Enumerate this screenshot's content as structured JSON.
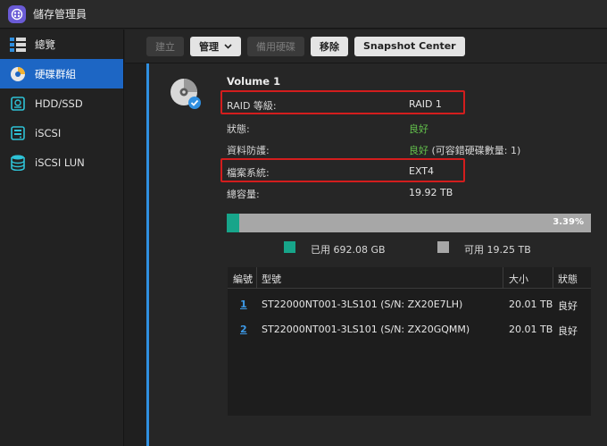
{
  "app": {
    "title": "儲存管理員"
  },
  "sidebar": {
    "items": [
      {
        "label": "總覽",
        "icon": "overview-icon"
      },
      {
        "label": "硬碟群組",
        "icon": "disk-group-icon",
        "active": true
      },
      {
        "label": "HDD/SSD",
        "icon": "hdd-icon"
      },
      {
        "label": "iSCSI",
        "icon": "iscsi-icon"
      },
      {
        "label": "iSCSI LUN",
        "icon": "iscsi-lun-icon"
      }
    ]
  },
  "toolbar": {
    "create": "建立",
    "manage": "管理",
    "spare": "備用硬碟",
    "remove": "移除",
    "snapshot": "Snapshot Center"
  },
  "volume": {
    "title": "Volume 1",
    "raid_label": "RAID 等級:",
    "raid_value": "RAID 1",
    "status_label": "狀態:",
    "status_value": "良好",
    "protection_label": "資料防護:",
    "protection_value": "良好",
    "protection_note": "(可容錯硬碟數量: 1)",
    "fs_label": "檔案系統:",
    "fs_value": "EXT4",
    "capacity_label": "總容量:",
    "capacity_value": "19.92 TB",
    "usage_percent_label": "3.39%",
    "usage_fraction": 0.0339,
    "used_label": "已用 692.08 GB",
    "free_label": "可用 19.25 TB",
    "used_color": "#17a58a",
    "free_color": "#a7a7a7",
    "status_color": "#63c04c"
  },
  "disk_table": {
    "headers": {
      "num": "編號",
      "model": "型號",
      "size": "大小",
      "status": "狀態"
    },
    "rows": [
      {
        "num": "1",
        "model": "ST22000NT001-3LS101 (S/N: ZX20E7LH)",
        "size": "20.01 TB",
        "status": "良好"
      },
      {
        "num": "2",
        "model": "ST22000NT001-3LS101 (S/N: ZX20GQMM)",
        "size": "20.01 TB",
        "status": "良好"
      }
    ]
  },
  "highlight_color": "#d31d1d",
  "accent_color": "#1d66c4"
}
